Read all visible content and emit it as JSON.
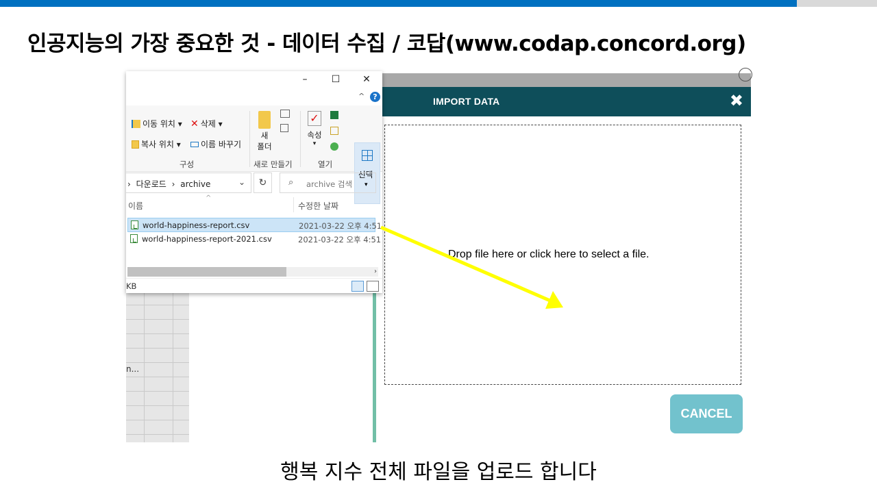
{
  "slide": {
    "title": "인공지능의 가장 중요한 것 - 데이터 수집 / 코답(www.codap.concord.org)",
    "caption": "행복 지수 전체 파일을 업로드 합니다",
    "accent_color": "#0070c0"
  },
  "explorer": {
    "window_buttons": {
      "minimize": "–",
      "maximize": "☐",
      "close": "✕"
    },
    "ribbon_collapse": "^",
    "help": "?",
    "ribbon": {
      "move_to": "이동 위치 ▾",
      "copy_to": "복사 위치 ▾",
      "delete": "삭제 ▾",
      "rename": "이름 바꾸기",
      "group_organize": "구성",
      "new_folder_line1": "새",
      "new_folder_line2": "폴더",
      "group_new": "새로 만들기",
      "properties": "속성",
      "properties_caret": "▾",
      "group_open": "열기",
      "select": "선택",
      "select_caret": "▾"
    },
    "address": {
      "separator": "›",
      "folder1": "다운로드",
      "separator2": "›",
      "folder2": "archive",
      "dropdown": "⌄"
    },
    "refresh": "↻",
    "search": {
      "icon": "⌕",
      "placeholder": "archive 검색"
    },
    "columns": {
      "name": "이름",
      "modified": "수정한 날짜",
      "sort_caret": "^"
    },
    "files": [
      {
        "name": "world-happiness-report.csv",
        "modified": "2021-03-22 오후 4:51",
        "selected": true
      },
      {
        "name": "world-happiness-report-2021.csv",
        "modified": "2021-03-22 오후 4:51",
        "selected": false
      }
    ],
    "scroll_right": "›",
    "status": "KB"
  },
  "background_sheet": {
    "cell_text": "n..."
  },
  "codap": {
    "dialog_title": "IMPORT DATA",
    "close_symbol": "✖",
    "drop_text": "Drop file here or click here to select a file.",
    "cancel_label": "CANCEL",
    "header_color": "#0e4e5a",
    "cancel_color": "#72c2cd"
  },
  "annotation": {
    "arrow_color": "#ffff00"
  }
}
